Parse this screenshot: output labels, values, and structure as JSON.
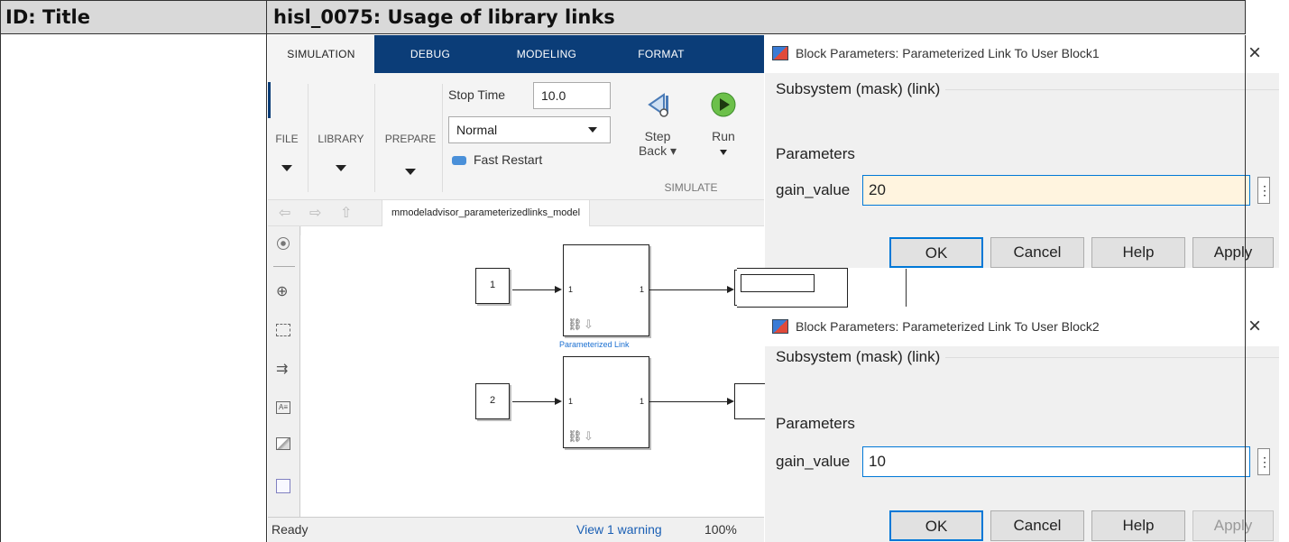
{
  "table": {
    "header_id": "ID: Title",
    "header_title": "hisl_0075: Usage of library links"
  },
  "simulink": {
    "tabs": [
      "SIMULATION",
      "DEBUG",
      "MODELING",
      "FORMAT"
    ],
    "ribbon": {
      "file": "FILE",
      "library": "LIBRARY",
      "prepare": "PREPARE",
      "stop_time_label": "Stop Time",
      "stop_time_value": "10.0",
      "mode_value": "Normal",
      "fast_restart": "Fast Restart",
      "step_back_line1": "Step",
      "step_back_line2": "Back ▾",
      "run": "Run",
      "simulate_section": "SIMULATE"
    },
    "model_tab": "mmodeladvisor_parameterizedlinks_model",
    "blocks": {
      "const1": "1",
      "const2": "2",
      "sub_in_port": "1",
      "sub_out_port": "1",
      "link_label": "Parameterized Link"
    },
    "status": {
      "ready": "Ready",
      "warning": "View 1 warning",
      "zoom": "100%"
    }
  },
  "dialogs": [
    {
      "title": "Block Parameters: Parameterized Link To User Block1",
      "type": "Subsystem (mask) (link)",
      "section": "Parameters",
      "param_label": "gain_value",
      "param_value": "20",
      "ok": "OK",
      "cancel": "Cancel",
      "help": "Help",
      "apply": "Apply"
    },
    {
      "title": "Block Parameters: Parameterized Link To User Block2",
      "type": "Subsystem (mask) (link)",
      "section": "Parameters",
      "param_label": "gain_value",
      "param_value": "10",
      "ok": "OK",
      "cancel": "Cancel",
      "help": "Help",
      "apply": "Apply"
    }
  ],
  "icons": {
    "close": "×",
    "ellipsis": "⋮"
  },
  "colors": {
    "tabbar": "#0b3d78",
    "header_gray": "#d9d9d9",
    "input_focus": "#0078d7",
    "input_highlight": "#fff4df"
  }
}
